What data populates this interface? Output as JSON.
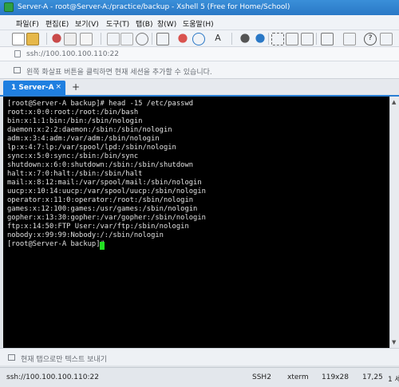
{
  "window": {
    "title": "Server-A - root@Server-A:/practice/backup - Xshell 5 (Free for Home/School)"
  },
  "menu": [
    "파일(F)",
    "편집(E)",
    "보기(V)",
    "도구(T)",
    "탭(B)",
    "창(W)",
    "도움말(H)"
  ],
  "address": {
    "text": "ssh://100.100.100.110:22"
  },
  "hint": {
    "text": "왼쪽 화살표 버튼을 클릭하면 현재 세션을 추가할 수 있습니다."
  },
  "tabs": [
    {
      "label": "1 Server-A",
      "close": "×"
    }
  ],
  "new_tab": "+",
  "terminal": {
    "lines": [
      "[root@Server-A backup]# head -15 /etc/passwd",
      "root:x:0:0:root:/root:/bin/bash",
      "bin:x:1:1:bin:/bin:/sbin/nologin",
      "daemon:x:2:2:daemon:/sbin:/sbin/nologin",
      "adm:x:3:4:adm:/var/adm:/sbin/nologin",
      "lp:x:4:7:lp:/var/spool/lpd:/sbin/nologin",
      "sync:x:5:0:sync:/sbin:/bin/sync",
      "shutdown:x:6:0:shutdown:/sbin:/sbin/shutdown",
      "halt:x:7:0:halt:/sbin:/sbin/halt",
      "mail:x:8:12:mail:/var/spool/mail:/sbin/nologin",
      "uucp:x:10:14:uucp:/var/spool/uucp:/sbin/nologin",
      "operator:x:11:0:operator:/root:/sbin/nologin",
      "games:x:12:100:games:/usr/games:/sbin/nologin",
      "gopher:x:13:30:gopher:/var/gopher:/sbin/nologin",
      "ftp:x:14:50:FTP User:/var/ftp:/sbin/nologin",
      "nobody:x:99:99:Nobody:/:/sbin/nologin",
      "[root@Server-A backup]# "
    ],
    "cursor_color": "#22e022"
  },
  "send_bar": {
    "text": "현재 탭으로만 텍스트 보내기"
  },
  "status": {
    "address": "ssh://100.100.100.110:22",
    "protocol": "SSH2",
    "terminal": "xterm",
    "size": "119x28",
    "position": "17,25",
    "sessions": "1 세"
  }
}
